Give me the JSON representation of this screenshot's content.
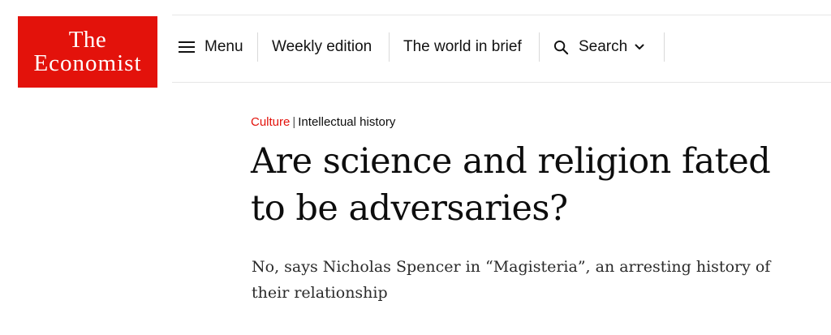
{
  "header": {
    "logo": {
      "line1": "The",
      "line2": "Economist",
      "color": "#e3120b"
    },
    "nav": {
      "menu_label": "Menu",
      "weekly_label": "Weekly edition",
      "brief_label": "The world in brief",
      "search_label": "Search"
    },
    "icons": [
      "hamburger-menu-icon",
      "search-icon",
      "chevron-down-icon"
    ]
  },
  "article": {
    "section": "Culture",
    "separator": "|",
    "subsection": "Intellectual history",
    "headline": "Are science and religion fated to be adversaries?",
    "rubric": "No, says Nicholas Spencer in “Magisteria”, an arresting history of their relationship"
  }
}
